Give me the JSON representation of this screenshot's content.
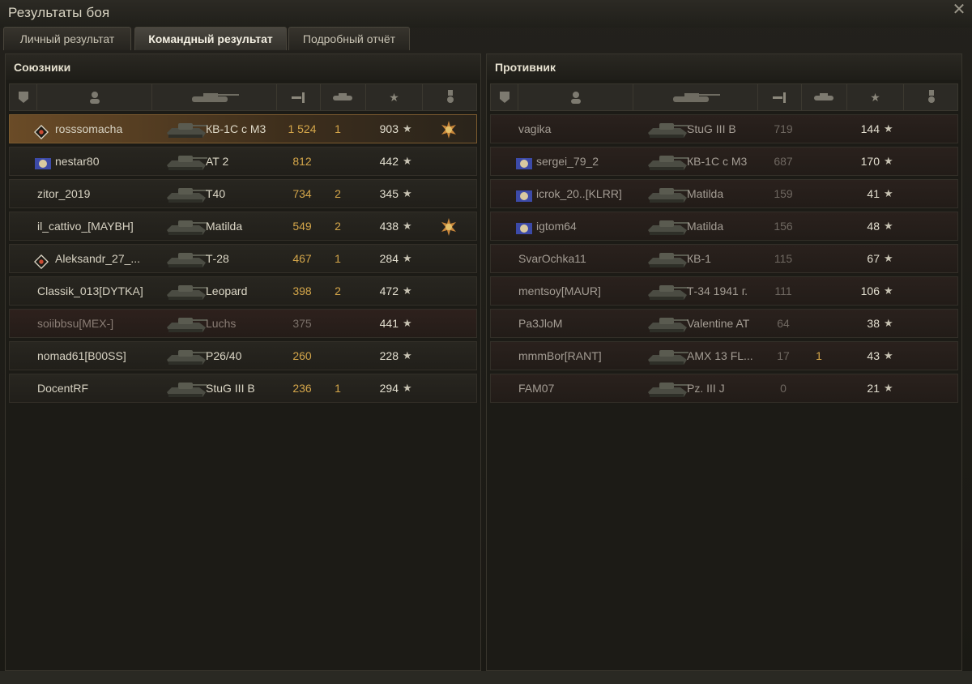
{
  "window": {
    "title": "Результаты боя",
    "close_icon": "close-icon"
  },
  "tabs": [
    {
      "label": "Личный результат",
      "active": false
    },
    {
      "label": "Командный результат",
      "active": true
    },
    {
      "label": "Подробный отчёт",
      "active": false
    }
  ],
  "allies": {
    "title": "Союзники",
    "rows": [
      {
        "name": "rosssomacha",
        "tank": "КВ-1С с М3",
        "damage": "1 524",
        "kills": "1",
        "xp": "903",
        "badge": "rank-icon",
        "medal": true,
        "highlight": true,
        "dead": false
      },
      {
        "name": "nestar80",
        "tank": "AT 2",
        "damage": "812",
        "kills": "",
        "xp": "442",
        "badge": "clan-badge",
        "medal": false,
        "highlight": false,
        "dead": false
      },
      {
        "name": "zitor_2019",
        "tank": "T40",
        "damage": "734",
        "kills": "2",
        "xp": "345",
        "badge": "",
        "medal": false,
        "highlight": false,
        "dead": false
      },
      {
        "name": "il_cattivo_[MAYBH]",
        "tank": "Matilda",
        "damage": "549",
        "kills": "2",
        "xp": "438",
        "badge": "",
        "medal": true,
        "highlight": false,
        "dead": false
      },
      {
        "name": "Aleksandr_27_...",
        "tank": "Т-28",
        "damage": "467",
        "kills": "1",
        "xp": "284",
        "badge": "rank-icon",
        "medal": false,
        "highlight": false,
        "dead": false
      },
      {
        "name": "Classik_013[DYTKA]",
        "tank": "Leopard",
        "damage": "398",
        "kills": "2",
        "xp": "472",
        "badge": "",
        "medal": false,
        "highlight": false,
        "dead": false
      },
      {
        "name": "soiibbsu[MEX-]",
        "tank": "Luchs",
        "damage": "375",
        "kills": "",
        "xp": "441",
        "badge": "",
        "medal": false,
        "highlight": false,
        "dead": true
      },
      {
        "name": "nomad61[B00SS]",
        "tank": "P26/40",
        "damage": "260",
        "kills": "",
        "xp": "228",
        "badge": "",
        "medal": false,
        "highlight": false,
        "dead": false
      },
      {
        "name": "DocentRF",
        "tank": "StuG III B",
        "damage": "236",
        "kills": "1",
        "xp": "294",
        "badge": "",
        "medal": false,
        "highlight": false,
        "dead": false
      }
    ]
  },
  "enemies": {
    "title": "Противник",
    "rows": [
      {
        "name": "vagika",
        "tank": "StuG III B",
        "damage": "719",
        "kills": "",
        "xp": "144",
        "badge": ""
      },
      {
        "name": "sergei_79_2",
        "tank": "КВ-1С с М3",
        "damage": "687",
        "kills": "",
        "xp": "170",
        "badge": "clan-badge"
      },
      {
        "name": "icrok_20..[KLRR]",
        "tank": "Matilda",
        "damage": "159",
        "kills": "",
        "xp": "41",
        "badge": "clan-badge"
      },
      {
        "name": "igtom64",
        "tank": "Matilda",
        "damage": "156",
        "kills": "",
        "xp": "48",
        "badge": "clan-badge"
      },
      {
        "name": "SvarOchka11",
        "tank": "КВ-1",
        "damage": "115",
        "kills": "",
        "xp": "67",
        "badge": ""
      },
      {
        "name": "mentsoy[MAUR]",
        "tank": "Т-34 1941 г.",
        "damage": "111",
        "kills": "",
        "xp": "106",
        "badge": ""
      },
      {
        "name": "Pa3JloM",
        "tank": "Valentine AT",
        "damage": "64",
        "kills": "",
        "xp": "38",
        "badge": ""
      },
      {
        "name": "mmmBor[RANT]",
        "tank": "AMX 13 FL...",
        "damage": "17",
        "kills": "1",
        "xp": "43",
        "badge": ""
      },
      {
        "name": "FAM07",
        "tank": "Pz. III J",
        "damage": "0",
        "kills": "",
        "xp": "21",
        "badge": ""
      }
    ]
  },
  "colors": {
    "accent": "#d4a64a",
    "highlight_row": "#6a4b27",
    "dead_row": "#2e211d"
  }
}
